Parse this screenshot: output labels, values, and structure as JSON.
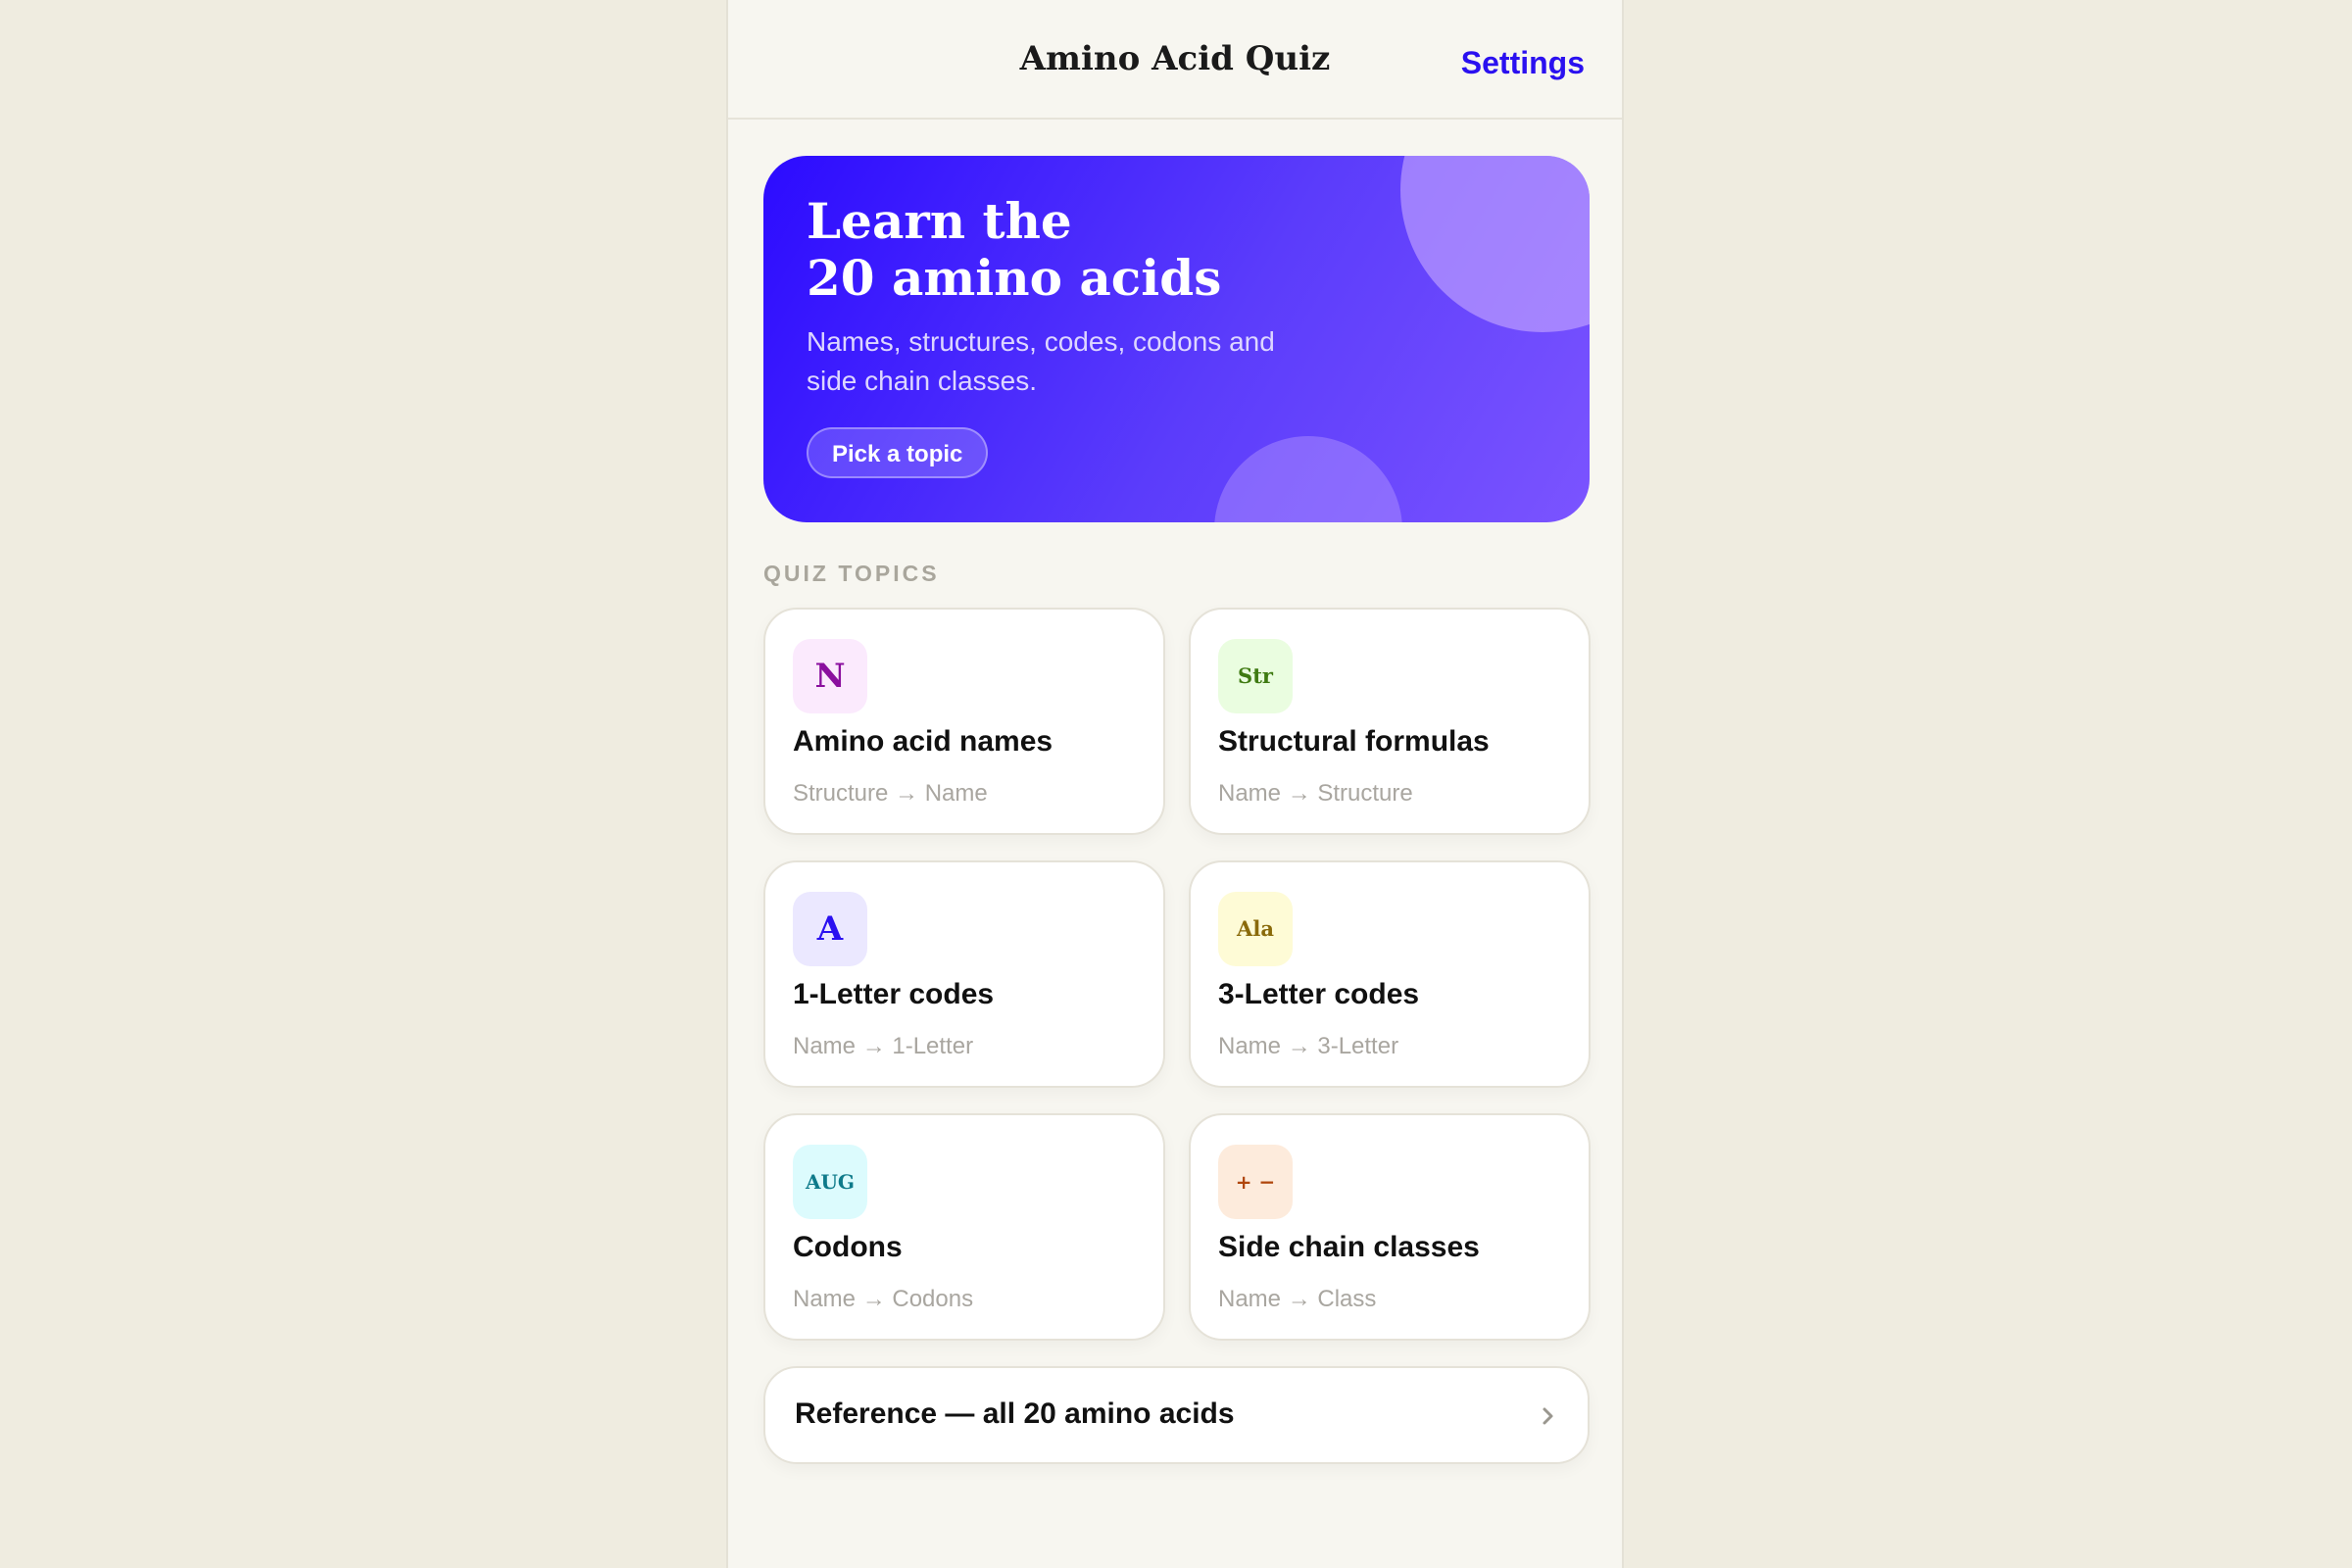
{
  "header": {
    "title": "Amino Acid Quiz",
    "settings_label": "Settings"
  },
  "hero": {
    "title_line1": "Learn the",
    "title_line2": "20 amino acids",
    "subtitle": "Names, structures, codes, codons and side chain classes.",
    "button_label": "Pick a topic"
  },
  "section": {
    "label": "QUIZ TOPICS"
  },
  "topics": [
    {
      "icon": "N",
      "title": "Amino acid names",
      "subtitle": "Structure → Name",
      "icon_bg": "#fbeafd",
      "icon_color": "#8a0f9e"
    },
    {
      "icon": "Str",
      "title": "Structural formulas",
      "subtitle": "Name → Structure",
      "icon_bg": "#eafde0",
      "icon_color": "#3f7a12"
    },
    {
      "icon": "A",
      "title": "1-Letter codes",
      "subtitle": "Name → 1-Letter",
      "icon_bg": "#ebe8ff",
      "icon_color": "#2a10f0"
    },
    {
      "icon": "Ala",
      "title": "3-Letter codes",
      "subtitle": "Name → 3-Letter",
      "icon_bg": "#fefbd6",
      "icon_color": "#8a6a0a"
    },
    {
      "icon": "AUG",
      "title": "Codons",
      "subtitle": "Name → Codons",
      "icon_bg": "#dcfbfd",
      "icon_color": "#0e7a8a"
    },
    {
      "icon": "+ −",
      "title": "Side chain classes",
      "subtitle": "Name → Class",
      "icon_bg": "#fdebdc",
      "icon_color": "#b0460c"
    }
  ],
  "reference": {
    "label": "Reference — all 20 amino acids",
    "icon": "chevron-right-icon"
  },
  "colors": {
    "accent": "#2a10f0",
    "background": "#efece0",
    "surface": "#f7f6f0"
  }
}
